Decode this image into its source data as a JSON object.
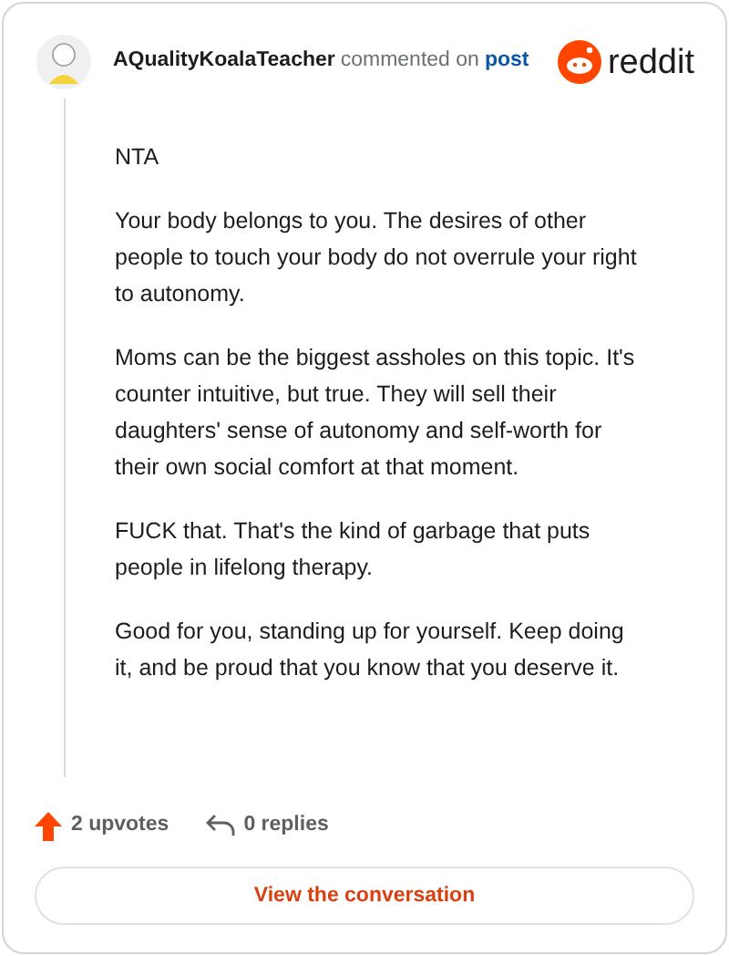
{
  "header": {
    "username": "AQualityKoalaTeacher",
    "action": "commented on",
    "link": "post",
    "brand": "reddit"
  },
  "paragraphs": [
    "NTA",
    "Your body belongs to you. The desires of other people to touch your body do not overrule your right to autonomy.",
    "Moms can be the biggest assholes on this topic. It's counter intuitive, but true. They will sell their daughters' sense of autonomy and self-worth for their own social comfort at that moment.",
    "FUCK that. That's the kind of garbage that puts people in lifelong therapy.",
    "Good for you, standing up for yourself. Keep doing it, and be proud that you know that you deserve it."
  ],
  "stats": {
    "upvotes": "2 upvotes",
    "replies": "0 replies"
  },
  "button": "View the conversation"
}
